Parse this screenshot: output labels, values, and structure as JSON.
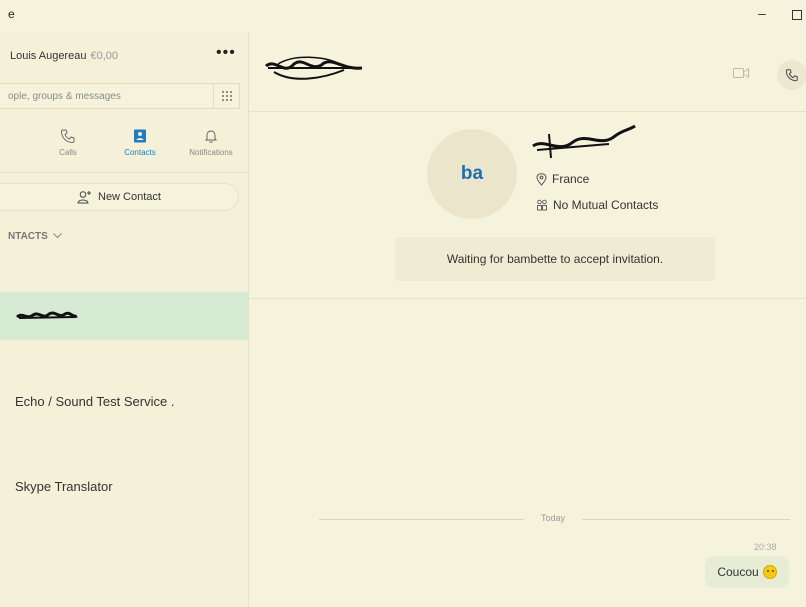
{
  "window": {
    "title": "e",
    "minimize": "–"
  },
  "profile": {
    "name": "Louis Augereau",
    "credit": "€0,00",
    "more": "•••"
  },
  "search": {
    "placeholder": "ople, groups & messages"
  },
  "tabs": [
    {
      "label": "Calls",
      "icon": "phone-icon"
    },
    {
      "label": "Contacts",
      "icon": "contacts-icon",
      "active": true
    },
    {
      "label": "Notifications",
      "icon": "bell-icon"
    }
  ],
  "new_contact": {
    "label": "New Contact"
  },
  "contacts_section": {
    "label": "NTACTS"
  },
  "contacts": [
    {
      "label": "",
      "redacted": true,
      "selected": true
    },
    {
      "label": "Echo / Sound Test Service ."
    },
    {
      "label": "Skype Translator"
    }
  ],
  "conversation": {
    "avatar_initials": "ba",
    "location": "France",
    "mutual": "No Mutual Contacts",
    "invite_text": "Waiting for bambette to accept invitation.",
    "day_label": "Today",
    "message": {
      "time": "20:38",
      "text": "Coucou"
    }
  },
  "colors": {
    "accent": "#1f7bc4",
    "selected_row": "#d6ead3",
    "background": "#f6f3dd"
  }
}
